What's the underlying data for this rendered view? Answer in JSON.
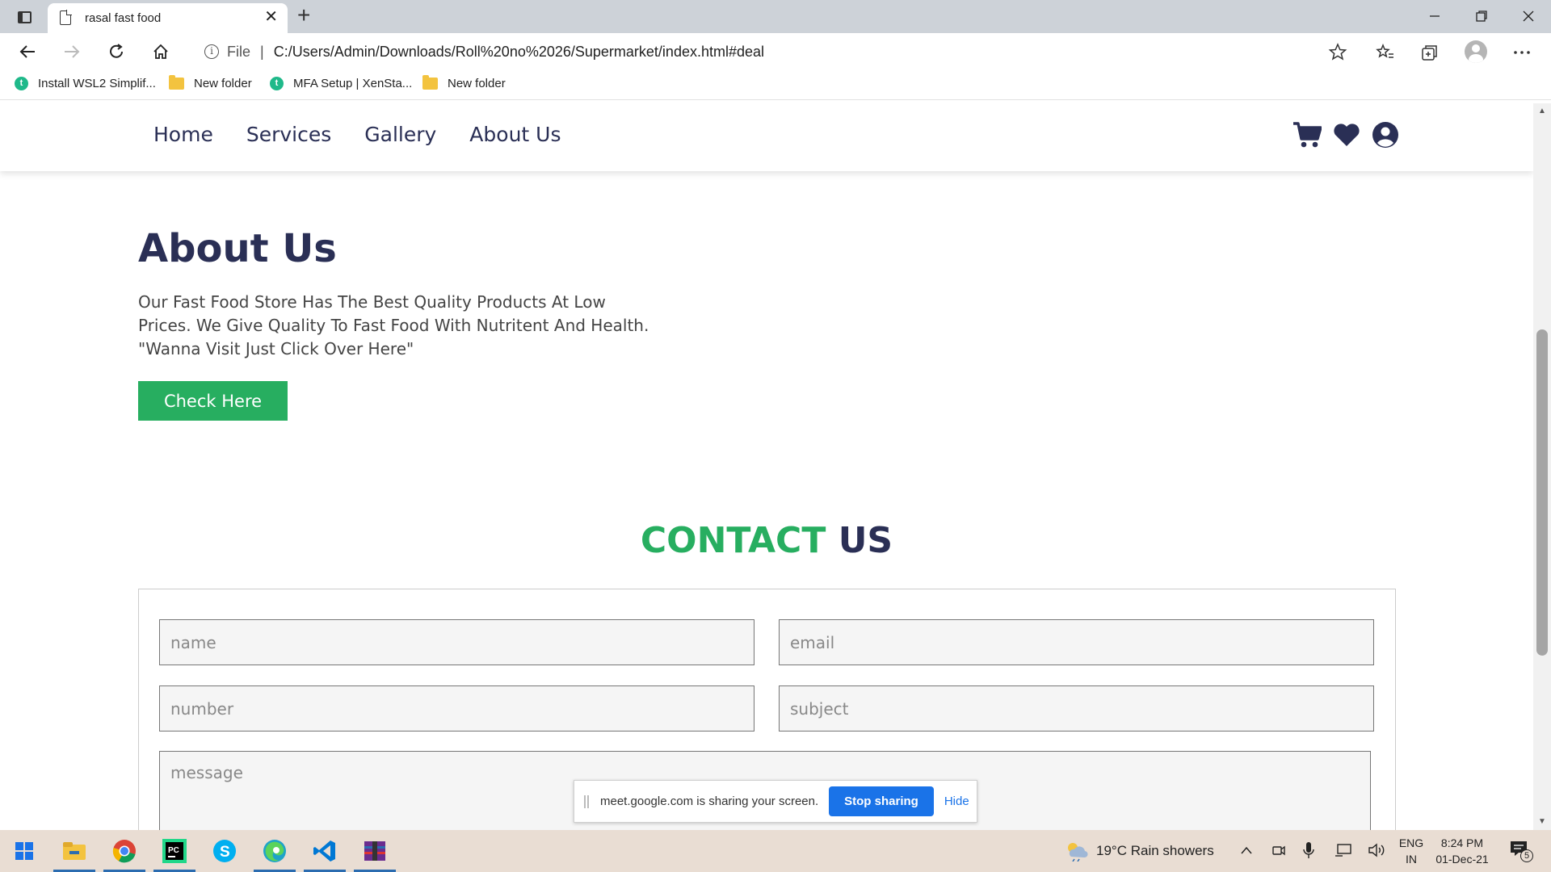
{
  "browser": {
    "tab_title": "rasal fast food",
    "tab_close": "✕",
    "new_tab": "+",
    "url_label": "File",
    "url_separator": "|",
    "url": "C:/Users/Admin/Downloads/Roll%20no%2026/Supermarket/index.html#deal",
    "bookmarks": [
      {
        "label": "Install WSL2 Simplif...",
        "icon": "twitter-bird-icon"
      },
      {
        "label": "New folder",
        "icon": "folder-icon"
      },
      {
        "label": "MFA Setup | XenSta...",
        "icon": "twitter-bird-icon"
      },
      {
        "label": "New folder",
        "icon": "folder-icon"
      }
    ]
  },
  "site": {
    "nav": [
      "Home",
      "Services",
      "Gallery",
      "About Us"
    ],
    "icons": [
      "cart-icon",
      "heart-icon",
      "user-icon"
    ],
    "about": {
      "title": "About Us",
      "text": "Our Fast Food Store Has The Best Quality Products At Low Prices. We Give Quality To Fast Food With Nutritent And Health. \"Wanna Visit Just Click Over Here\"",
      "button": "Check Here"
    },
    "contact": {
      "title_green": "CONTACT",
      "title_dark": "US",
      "placeholders": {
        "name": "name",
        "email": "email",
        "number": "number",
        "subject": "subject",
        "message": "message"
      }
    },
    "colors": {
      "accent": "#27ae60",
      "dark": "#2a2f55"
    }
  },
  "share_bar": {
    "message": "meet.google.com is sharing your screen.",
    "stop": "Stop sharing",
    "hide": "Hide"
  },
  "taskbar": {
    "weather": "19°C  Rain showers",
    "lang_top": "ENG",
    "lang_bottom": "IN",
    "time": "8:24 PM",
    "date": "01-Dec-21",
    "notifications": "5"
  }
}
